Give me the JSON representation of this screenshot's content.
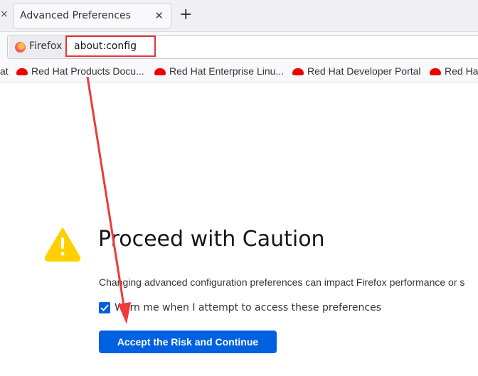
{
  "tabs": [
    {
      "title": "Advanced Preferences",
      "close_icon": "close-icon"
    }
  ],
  "new_tab_icon": "plus-icon",
  "urlbar": {
    "identity_label": "Firefox",
    "url": "about:config"
  },
  "bookmarks": [
    {
      "label": "at"
    },
    {
      "label": "Red Hat Products Docu..."
    },
    {
      "label": "Red Hat Enterprise Linu..."
    },
    {
      "label": "Red Hat Developer Portal"
    },
    {
      "label": "Red Ha"
    }
  ],
  "page": {
    "title": "Proceed with Caution",
    "description": "Changing advanced configuration preferences can impact Firefox performance or s",
    "checkbox_label": "Warn me when I attempt to access these preferences",
    "checkbox_checked": true,
    "accept_button": "Accept the Risk and Continue"
  },
  "colors": {
    "accent": "#0061e0",
    "warning": "#ffd000",
    "annotation": "#e53535"
  }
}
